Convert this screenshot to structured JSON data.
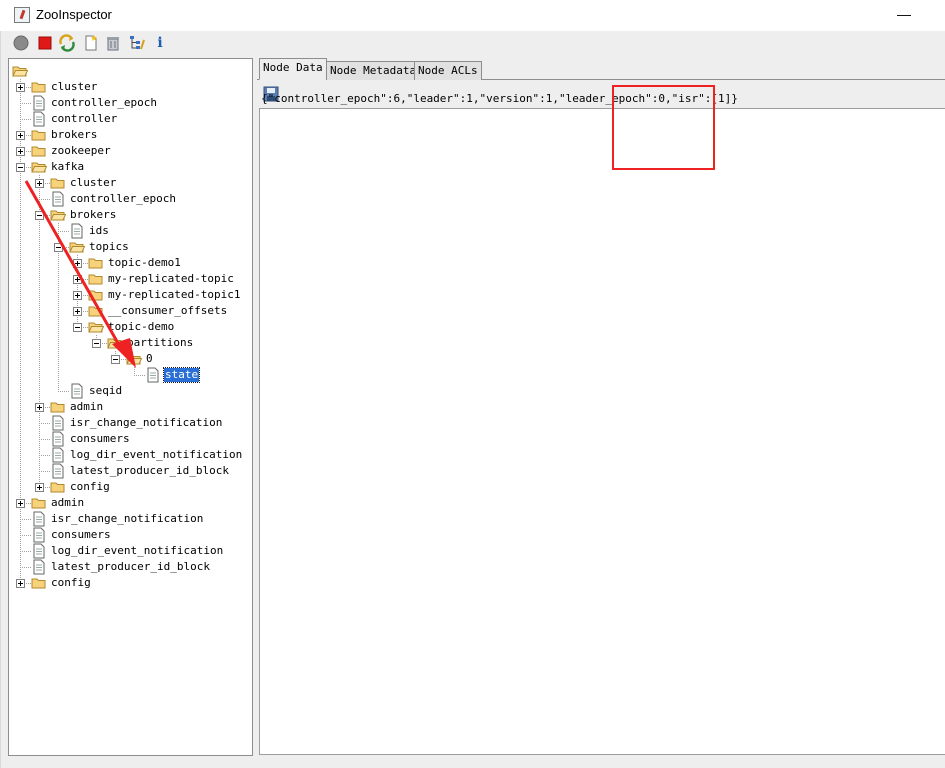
{
  "window": {
    "title": "ZooInspector",
    "minimize_label": "—"
  },
  "toolbar": {
    "buttons": [
      {
        "name": "connect-button",
        "icon": "connect-icon"
      },
      {
        "name": "disconnect-button",
        "icon": "disconnect-icon"
      },
      {
        "name": "refresh-button",
        "icon": "refresh-icon"
      },
      {
        "name": "add-node-button",
        "icon": "add-node-icon"
      },
      {
        "name": "delete-node-button",
        "icon": "trash-icon"
      },
      {
        "name": "node-viewers-button",
        "icon": "node-viewers-icon"
      },
      {
        "name": "about-button",
        "icon": "info-icon"
      }
    ],
    "info_glyph": "i"
  },
  "tree": {
    "nodes": [
      {
        "label": "",
        "type": "folder",
        "depth": 0,
        "expander": "none"
      },
      {
        "label": "cluster",
        "type": "folder",
        "depth": 1,
        "expander": "plus"
      },
      {
        "label": "controller_epoch",
        "type": "file",
        "depth": 1,
        "expander": "none"
      },
      {
        "label": "controller",
        "type": "file",
        "depth": 1,
        "expander": "none"
      },
      {
        "label": "brokers",
        "type": "folder",
        "depth": 1,
        "expander": "plus"
      },
      {
        "label": "zookeeper",
        "type": "folder",
        "depth": 1,
        "expander": "plus"
      },
      {
        "label": "kafka",
        "type": "folder",
        "depth": 1,
        "expander": "minus"
      },
      {
        "label": "cluster",
        "type": "folder",
        "depth": 2,
        "expander": "plus"
      },
      {
        "label": "controller_epoch",
        "type": "file",
        "depth": 2,
        "expander": "none"
      },
      {
        "label": "brokers",
        "type": "folder",
        "depth": 2,
        "expander": "minus"
      },
      {
        "label": "ids",
        "type": "file",
        "depth": 3,
        "expander": "none"
      },
      {
        "label": "topics",
        "type": "folder",
        "depth": 3,
        "expander": "minus"
      },
      {
        "label": "topic-demo1",
        "type": "folder",
        "depth": 4,
        "expander": "plus"
      },
      {
        "label": "my-replicated-topic",
        "type": "folder",
        "depth": 4,
        "expander": "plus"
      },
      {
        "label": "my-replicated-topic1",
        "type": "folder",
        "depth": 4,
        "expander": "plus"
      },
      {
        "label": "__consumer_offsets",
        "type": "folder",
        "depth": 4,
        "expander": "plus"
      },
      {
        "label": "topic-demo",
        "type": "folder",
        "depth": 4,
        "expander": "minus"
      },
      {
        "label": "partitions",
        "type": "folder",
        "depth": 5,
        "expander": "minus"
      },
      {
        "label": "0",
        "type": "folder",
        "depth": 6,
        "expander": "minus"
      },
      {
        "label": "state",
        "type": "file",
        "depth": 7,
        "expander": "none",
        "selected": true
      },
      {
        "label": "seqid",
        "type": "file",
        "depth": 3,
        "expander": "none"
      },
      {
        "label": "admin",
        "type": "folder",
        "depth": 2,
        "expander": "plus"
      },
      {
        "label": "isr_change_notification",
        "type": "file",
        "depth": 2,
        "expander": "none"
      },
      {
        "label": "consumers",
        "type": "file",
        "depth": 2,
        "expander": "none"
      },
      {
        "label": "log_dir_event_notification",
        "type": "file",
        "depth": 2,
        "expander": "none"
      },
      {
        "label": "latest_producer_id_block",
        "type": "file",
        "depth": 2,
        "expander": "none"
      },
      {
        "label": "config",
        "type": "folder",
        "depth": 2,
        "expander": "plus"
      },
      {
        "label": "admin",
        "type": "folder",
        "depth": 1,
        "expander": "plus"
      },
      {
        "label": "isr_change_notification",
        "type": "file",
        "depth": 1,
        "expander": "none"
      },
      {
        "label": "consumers",
        "type": "file",
        "depth": 1,
        "expander": "none"
      },
      {
        "label": "log_dir_event_notification",
        "type": "file",
        "depth": 1,
        "expander": "none"
      },
      {
        "label": "latest_producer_id_block",
        "type": "file",
        "depth": 1,
        "expander": "none"
      },
      {
        "label": "config",
        "type": "folder",
        "depth": 1,
        "expander": "plus"
      }
    ]
  },
  "tabs": [
    {
      "label": "Node Data",
      "active": true
    },
    {
      "label": "Node Metadata",
      "active": false
    },
    {
      "label": "Node ACLs",
      "active": false
    }
  ],
  "node_data": {
    "text": "{\"controller_epoch\":6,\"leader\":1,\"version\":1,\"leader_epoch\":0,\"isr\":[1]}"
  },
  "colors": {
    "annotation": "#ee2222",
    "selection": "#2a6fd6",
    "folder_fill": "#f7d27a",
    "folder_stroke": "#b08a2e"
  }
}
